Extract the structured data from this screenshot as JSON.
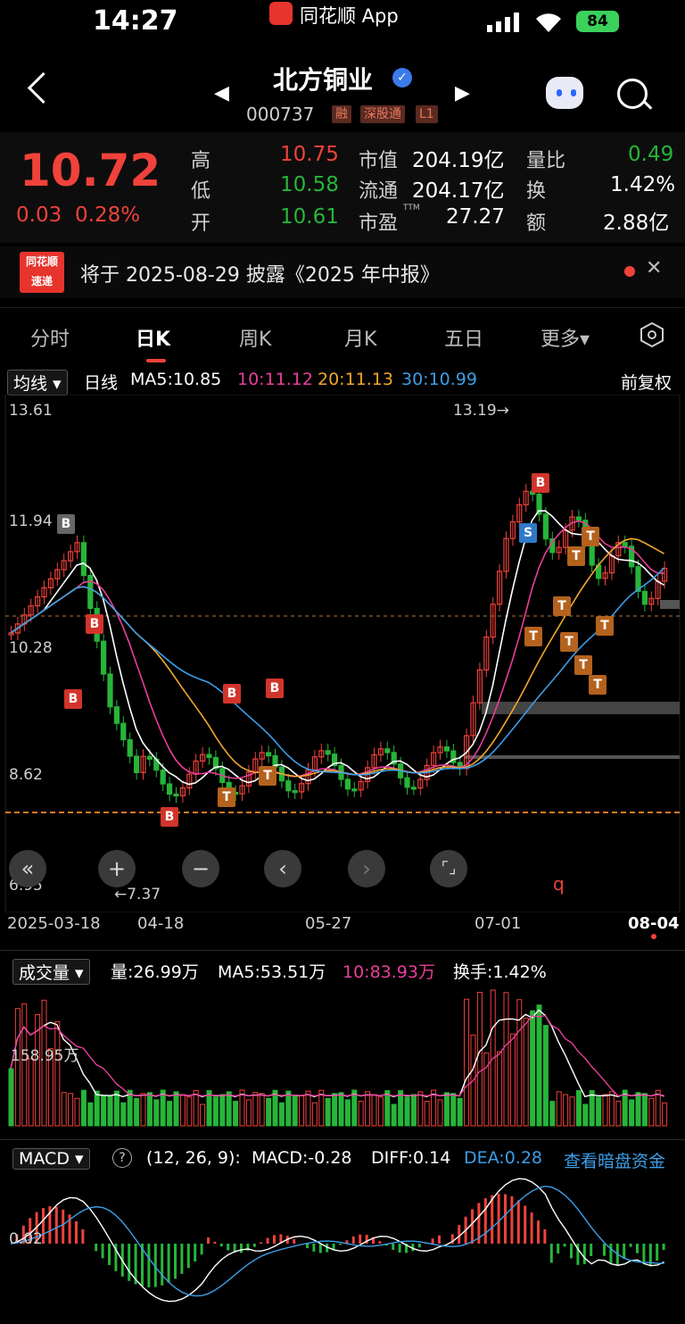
{
  "status_bar": {
    "time": "14:27",
    "app_name": "同花顺 App",
    "battery": "84"
  },
  "header": {
    "stock_name": "北方铜业",
    "stock_code": "000737",
    "tags": [
      "融",
      "深股通",
      "L1"
    ],
    "icons": [
      "back-chevron-icon",
      "prev-triangle-icon",
      "next-triangle-icon",
      "robot-icon",
      "search-icon"
    ]
  },
  "quote": {
    "price": "10.72",
    "change": "0.03",
    "change_pct": "0.28%",
    "high_label": "高",
    "high": "10.75",
    "low_label": "低",
    "low": "10.58",
    "open_label": "开",
    "open": "10.61",
    "mcap_label": "市值",
    "mcap": "204.19亿",
    "float_label": "流通",
    "float": "204.17亿",
    "pe_label": "市盈",
    "pe_sup": "TTM",
    "pe": "27.27",
    "vol_ratio_label": "量比",
    "vol_ratio": "0.49",
    "turnover_label": "换",
    "turnover": "1.42%",
    "amount_label": "额",
    "amount": "2.88亿"
  },
  "news": {
    "logo_line1": "同花顺",
    "logo_line2": "速递",
    "text": "将于 2025-08-29 披露《2025 年中报》"
  },
  "tabs": [
    {
      "label": "分时"
    },
    {
      "label": "日K"
    },
    {
      "label": "周K"
    },
    {
      "label": "月K"
    },
    {
      "label": "五日"
    },
    {
      "label": "更多▾"
    }
  ],
  "indicator": {
    "ma_dropdown": "均线 ▾",
    "period": "日线",
    "ma5": "MA5:10.85",
    "ma10": "10:11.12",
    "ma20": "20:11.13",
    "ma30": "30:10.99",
    "adjust": "前复权"
  },
  "kchart": {
    "y_labels": [
      "13.61",
      "11.94",
      "10.28",
      "8.62",
      "6.95"
    ],
    "high_note": "13.19→",
    "low_note": "←7.37",
    "dates": [
      "2025-03-18",
      "04-18",
      "05-27",
      "07-01",
      "08-04"
    ],
    "tools": [
      "«",
      "+",
      "−",
      "‹",
      "›",
      "⌜⌟"
    ],
    "markers": [
      "B",
      "B",
      "B",
      "B",
      "B",
      "B",
      "B",
      "S",
      "T",
      "T",
      "T",
      "T",
      "T",
      "T",
      "T",
      "T",
      "T",
      "T"
    ]
  },
  "volume": {
    "dropdown": "成交量 ▾",
    "vol": "量:26.99万",
    "ma5": "MA5:53.51万",
    "ma10": "10:83.93万",
    "turnover": "换手:1.42%",
    "axis": "158.95万"
  },
  "macd": {
    "dropdown": "MACD ▾",
    "help": "?",
    "params": "(12, 26, 9):",
    "macd": "MACD:-0.28",
    "diff": "DIFF:0.14",
    "dea": "DEA:0.28",
    "link": "查看暗盘资金",
    "axis": "0.02"
  },
  "colors": {
    "up": "#f0423b",
    "down": "#27b53a",
    "ma5": "#ffffff",
    "ma10": "#e83e9b",
    "ma20": "#f0a72b",
    "ma30": "#3c9ee8"
  }
}
